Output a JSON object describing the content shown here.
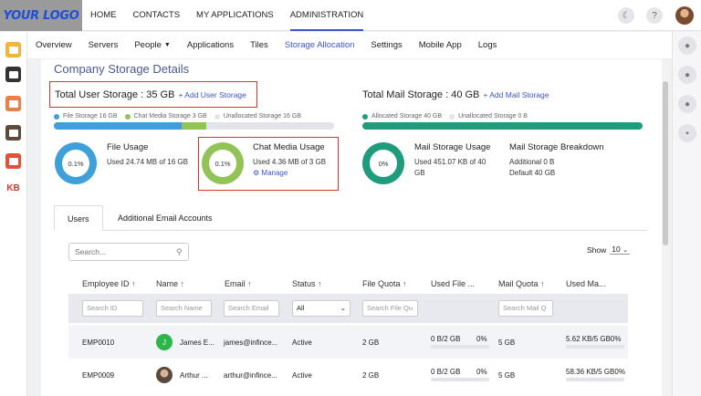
{
  "brand": {
    "logo_text": "YOUR LOGO"
  },
  "topnav": [
    "HOME",
    "CONTACTS",
    "MY APPLICATIONS",
    "ADMINISTRATION"
  ],
  "topnav_active": "ADMINISTRATION",
  "subnav": [
    "Overview",
    "Servers",
    "People",
    "Applications",
    "Tiles",
    "Storage Allocation",
    "Settings",
    "Mobile App",
    "Logs"
  ],
  "subnav_active": "Storage Allocation",
  "left_rail_apps": [
    {
      "icon": "notes-app-icon",
      "color": "#f2b43a"
    },
    {
      "icon": "contacts-app-icon",
      "color": "#333333"
    },
    {
      "icon": "calendar-app-icon",
      "color": "#e8804a"
    },
    {
      "icon": "tasks-app-icon",
      "color": "#5c4a3a"
    },
    {
      "icon": "photos-app-icon",
      "color": "#e0533a"
    },
    {
      "icon": "kb-app-icon",
      "label": "KB",
      "color": "#d03a2a"
    }
  ],
  "right_rail_icons": [
    "chat-icon",
    "person-icon",
    "group-icon",
    "calendar-check-icon"
  ],
  "page_title": "Company Storage Details",
  "user_storage": {
    "title": "Total User Storage : 35 GB",
    "add_link": "+ Add User Storage",
    "legend": [
      "File Storage 16 GB",
      "Chat Media Storage 3 GB",
      "Unallocated Storage 16 GB"
    ],
    "segments": [
      {
        "value": 16,
        "color": "#3f9fd8"
      },
      {
        "value": 3,
        "color": "#92c356"
      },
      {
        "value": 16,
        "color": "#e3e4ea"
      }
    ],
    "total": 35,
    "file_usage": {
      "title": "File Usage",
      "percent_label": "0.1%",
      "percent": 0.1,
      "text": "Used 24.74 MB of 16 GB",
      "color": "#3f9fd8"
    },
    "chat_usage": {
      "title": "Chat Media Usage",
      "percent_label": "0.1%",
      "percent": 0.1,
      "text": "Used 4.36 MB of 3 GB",
      "manage": "Manage",
      "color": "#92c356"
    }
  },
  "mail_storage": {
    "title": "Total Mail Storage : 40 GB",
    "add_link": "+ Add Mail Storage",
    "legend": [
      "Allocated Storage 40 GB",
      "Unallocated Storage 0 B"
    ],
    "segments": [
      {
        "value": 40,
        "color": "#1f9c7c"
      },
      {
        "value": 0,
        "color": "#e3e4ea"
      }
    ],
    "total": 40,
    "usage": {
      "title": "Mail Storage Usage",
      "percent_label": "0%",
      "percent": 0,
      "text_line1": "Used 451.07 KB of 40",
      "text_line2": "GB",
      "color": "#1f9c7c"
    },
    "breakdown": {
      "title": "Mail Storage Breakdown",
      "line1": "Additional 0 B",
      "line2": "Default 40 GB"
    }
  },
  "tabs": [
    "Users",
    "Additional Email Accounts"
  ],
  "tab_active": "Users",
  "search_placeholder": "Search...",
  "show": {
    "label": "Show",
    "value": "10"
  },
  "columns": [
    "Employee ID",
    "Name",
    "Email",
    "Status",
    "File Quota",
    "Used File ...",
    "Mail Quota",
    "Used Ma..."
  ],
  "sort_arrow": "↑",
  "filters": [
    "Search ID",
    "Search Name",
    "Search Email",
    "All",
    "Search File Qu",
    "",
    "Search Mail Q",
    ""
  ],
  "rows": [
    {
      "id": "EMP0010",
      "avatar": "J",
      "avatar_color": "#2bb54a",
      "name": "James E...",
      "email": "james@infince...",
      "status": "Active",
      "file_quota": "2 GB",
      "used_file": "0 B/2 GB",
      "used_file_pct": "0%",
      "mail_quota": "5 GB",
      "used_mail": "5.62 KB/5 GB0%"
    },
    {
      "id": "EMP0009",
      "avatar": "",
      "avatar_color": "#6b5a4a",
      "name": "Arthur ...",
      "email": "arthur@infince...",
      "status": "Active",
      "file_quota": "2 GB",
      "used_file": "0 B/2 GB",
      "used_file_pct": "0%",
      "mail_quota": "5 GB",
      "used_mail": "58.36 KB/5 GB0%"
    }
  ]
}
